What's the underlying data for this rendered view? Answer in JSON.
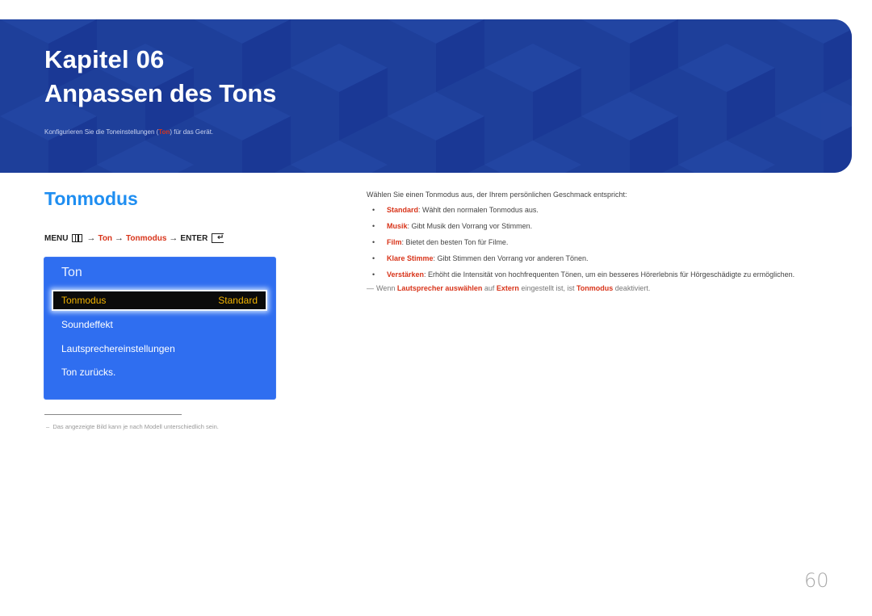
{
  "banner": {
    "chapter": "Kapitel 06",
    "title": "Anpassen des Tons",
    "subtitle_before": "Konfigurieren Sie die Toneinstellungen (",
    "subtitle_highlight": "Ton",
    "subtitle_after": ") für das Gerät."
  },
  "section": {
    "title": "Tonmodus"
  },
  "menu_path": {
    "menu": "MENU",
    "menu_icon": "menu-icon",
    "arrow": "→",
    "step1": "Ton",
    "step2": "Tonmodus",
    "enter": "ENTER",
    "enter_icon": "enter-icon"
  },
  "osd": {
    "title": "Ton",
    "selected": {
      "label": "Tonmodus",
      "value": "Standard"
    },
    "items": [
      "Soundeffekt",
      "Lautsprechereinstellungen",
      "Ton zurücks."
    ]
  },
  "footnote": {
    "dash": "–",
    "text": "Das angezeigte Bild kann je nach Modell unterschiedlich sein."
  },
  "description": {
    "intro": "Wählen Sie einen Tonmodus aus, der Ihrem persönlichen Geschmack entspricht:",
    "bullet": "•",
    "options": [
      {
        "term": "Standard",
        "text": ": Wählt den normalen Tonmodus aus."
      },
      {
        "term": "Musik",
        "text": ": Gibt Musik den Vorrang vor Stimmen."
      },
      {
        "term": "Film",
        "text": ": Bietet den besten Ton für Filme."
      },
      {
        "term": "Klare Stimme",
        "text": ": Gibt Stimmen den Vorrang vor anderen Tönen."
      },
      {
        "term": "Verstärken",
        "text": ": Erhöht die Intensität von hochfrequenten Tönen, um ein besseres Hörerlebnis für Hörgeschädigte zu ermöglichen."
      }
    ],
    "note": {
      "dash": "—",
      "p1": "Wenn ",
      "b1": "Lautsprecher auswählen",
      "p2": " auf ",
      "b2": "Extern",
      "p3": " eingestellt ist, ist ",
      "b3": "Tonmodus",
      "p4": " deaktiviert."
    }
  },
  "page": {
    "number": "60"
  },
  "colors": {
    "banner_blue": "#1e3f9a",
    "heading_blue": "#1f8ef1",
    "highlight_red": "#d8341a",
    "osd_blue": "#2f6ef0",
    "osd_selected_text": "#f3b400"
  }
}
